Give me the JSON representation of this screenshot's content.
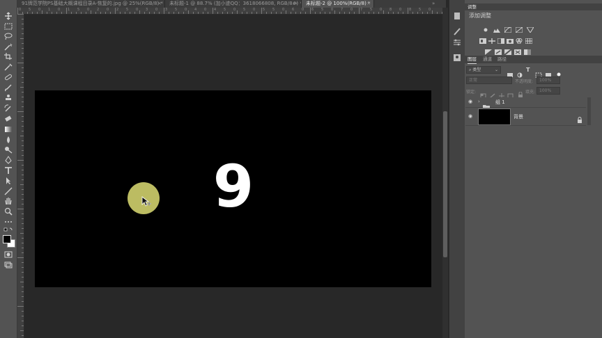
{
  "tabs": [
    {
      "label": "91牌范学院PS基础大概课程目录A-恢复的.jpg @ 25%(RGB/8) *",
      "active": false
    },
    {
      "label": "未标题-1 @ 88.7% (加小迹QQ：3618066808, RGB/8#) *",
      "active": false
    },
    {
      "label": "未标题-2 @ 100%(RGB/8) *",
      "active": true
    }
  ],
  "tab_close": "×",
  "ruler_numbers_top": [
    "0",
    "5",
    "0",
    "1",
    "0",
    "1",
    "5",
    "0",
    "2",
    "0",
    "2",
    "5",
    "0",
    "3",
    "0",
    "3",
    "5",
    "0",
    "4",
    "0",
    "4",
    "5",
    "0",
    "5",
    "0",
    "5",
    "5",
    "0",
    "6",
    "0",
    "6",
    "5",
    "0",
    "7",
    "0",
    "7",
    "5",
    "0",
    "8",
    "0",
    "8",
    "5",
    "0"
  ],
  "canvas": {
    "countdown_digit": "9",
    "document_color": "#000000",
    "cursor_halo_color": "#bcbc62"
  },
  "panels": {
    "adjustments_tab": "调整",
    "adjustments_title": "添加调整",
    "layers_tabs": [
      "图层",
      "通道",
      "路径"
    ],
    "filter_kind": "类型",
    "blend_mode": "正常",
    "opacity_label": "不透明度:",
    "opacity_value": "100%",
    "lock_label": "锁定:",
    "fill_label": "填充:",
    "fill_value": "100%",
    "layers": [
      {
        "name": "组 1",
        "type": "group"
      },
      {
        "name": "背景",
        "type": "background"
      }
    ]
  }
}
